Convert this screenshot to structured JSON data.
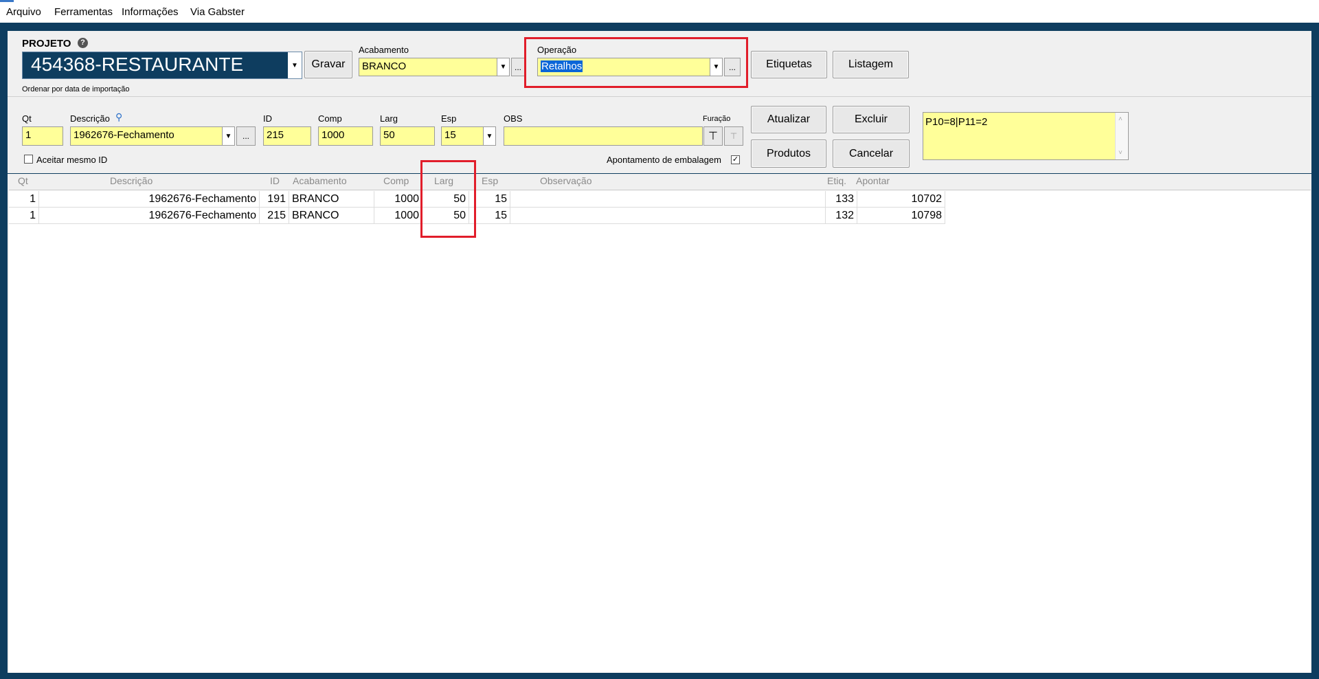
{
  "menu": [
    "Arquivo",
    "Ferramentas",
    "Informações",
    "Via Gabster"
  ],
  "project": {
    "label": "PROJETO",
    "value": "454368-RESTAURANTE",
    "hint": "Ordenar por data de importação",
    "save_label": "Gravar"
  },
  "acabamento": {
    "label": "Acabamento",
    "value": "BRANCO",
    "more_label": "..."
  },
  "operacao": {
    "label": "Operação",
    "value": "Retalhos",
    "more_label": "..."
  },
  "top_buttons": {
    "etiquetas": "Etiquetas",
    "listagem": "Listagem"
  },
  "form": {
    "qt": {
      "label": "Qt",
      "value": "1"
    },
    "descricao": {
      "label": "Descrição",
      "value": "1962676-Fechamento",
      "more_label": "..."
    },
    "id": {
      "label": "ID",
      "value": "215"
    },
    "comp": {
      "label": "Comp",
      "value": "1000"
    },
    "larg": {
      "label": "Larg",
      "value": "50"
    },
    "esp": {
      "label": "Esp",
      "value": "15"
    },
    "obs": {
      "label": "OBS",
      "value": ""
    },
    "furacao": {
      "label": "Furação"
    },
    "aceitar_label": "Aceitar mesmo ID",
    "aceitar_checked": false,
    "apontamento_label": "Apontamento de embalagem",
    "apontamento_checked": true,
    "buttons": {
      "atualizar": "Atualizar",
      "excluir": "Excluir",
      "produtos": "Produtos",
      "cancelar": "Cancelar"
    },
    "notes": "P10=8|P11=2"
  },
  "table": {
    "columns": [
      "Qt",
      "Descrição",
      "ID",
      "Acabamento",
      "Comp",
      "Larg",
      "Esp",
      "Observação",
      "Etiq.",
      "Apontar"
    ],
    "rows": [
      {
        "qt": "1",
        "descricao": "1962676-Fechamento",
        "id": "191",
        "acabamento": "BRANCO",
        "comp": "1000",
        "larg": "50",
        "esp": "15",
        "obs": "",
        "etiq": "133",
        "apontar": "10702"
      },
      {
        "qt": "1",
        "descricao": "1962676-Fechamento",
        "id": "215",
        "acabamento": "BRANCO",
        "comp": "1000",
        "larg": "50",
        "esp": "15",
        "obs": "",
        "etiq": "132",
        "apontar": "10798"
      }
    ]
  },
  "colors": {
    "frame": "#0e3d5f",
    "field": "#ffff99",
    "highlight": "#e11d2a",
    "selection": "#0a66d8"
  }
}
